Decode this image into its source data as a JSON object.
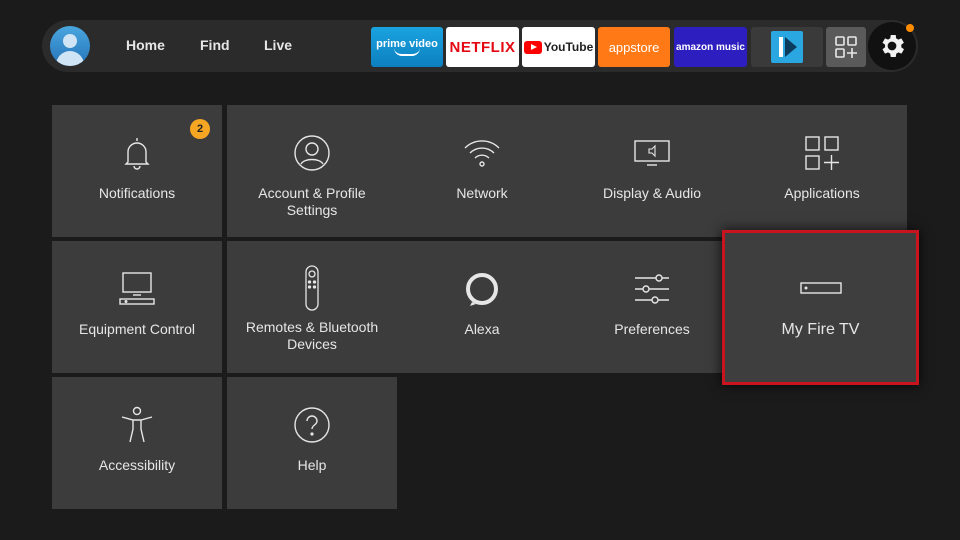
{
  "nav": {
    "links": [
      "Home",
      "Find",
      "Live"
    ]
  },
  "apps": {
    "prime_video": "prime video",
    "netflix": "NETFLIX",
    "youtube": "YouTube",
    "appstore": "appstore",
    "amazon_music": "amazon music"
  },
  "settings": {
    "tiles": [
      {
        "label": "Notifications",
        "icon": "bell-icon",
        "badge": "2"
      },
      {
        "label": "Account & Profile Settings",
        "icon": "profile-icon"
      },
      {
        "label": "Network",
        "icon": "wifi-icon"
      },
      {
        "label": "Display & Audio",
        "icon": "display-icon"
      },
      {
        "label": "Applications",
        "icon": "apps-grid-icon"
      },
      {
        "label": "Equipment Control",
        "icon": "tv-equipment-icon"
      },
      {
        "label": "Remotes & Bluetooth Devices",
        "icon": "remote-icon"
      },
      {
        "label": "Alexa",
        "icon": "alexa-icon"
      },
      {
        "label": "Preferences",
        "icon": "sliders-icon"
      },
      {
        "label": "My Fire TV",
        "icon": "fire-tv-device-icon",
        "focused": true
      },
      {
        "label": "Accessibility",
        "icon": "accessibility-icon"
      },
      {
        "label": "Help",
        "icon": "help-icon"
      }
    ]
  },
  "colors": {
    "focus_border": "#c8141e",
    "badge": "#f5a623",
    "notification_dot": "#ff8c00"
  }
}
